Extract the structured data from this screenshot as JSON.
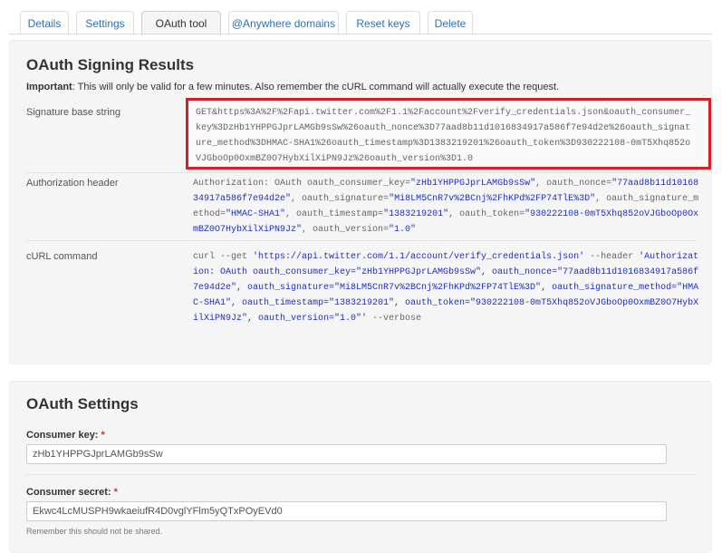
{
  "tabs": [
    {
      "label": "Details"
    },
    {
      "label": "Settings"
    },
    {
      "label": "OAuth tool"
    },
    {
      "label": "@Anywhere domains"
    },
    {
      "label": "Reset keys"
    },
    {
      "label": "Delete"
    }
  ],
  "results": {
    "title": "OAuth Signing Results",
    "important_label": "Important",
    "important_text": ": This will only be valid for a few minutes. Also remember the cURL command will actually execute the request.",
    "signature_label": "Signature base string",
    "signature_value": "GET&https%3A%2F%2Fapi.twitter.com%2F1.1%2Faccount%2Fverify_credentials.json&oauth_consumer_key%3DzHb1YHPPGJprLAMGb9sSw%26oauth_nonce%3D77aad8b11d1016834917a586f7e94d2e%26oauth_signature_method%3DHMAC-SHA1%26oauth_timestamp%3D1383219201%26oauth_token%3D930222108-0mT5Xhq852oVJGboOp0OxmBZ0O7HybXilXiPN9Jz%26oauth_version%3D1.0",
    "auth_label": "Authorization header",
    "auth_value": "Authorization: OAuth oauth_consumer_key=\"zHb1YHPPGJprLAMGb9sSw\", oauth_nonce=\"77aad8b11d1016834917a586f7e94d2e\", oauth_signature=\"Mi8LM5CnR7v%2BCnj%2FhKPd%2FP74TlE%3D\", oauth_signature_method=\"HMAC-SHA1\", oauth_timestamp=\"1383219201\", oauth_token=\"930222108-0mT5Xhq852oVJGboOp0OxmBZ0O7HybXilXiPN9Jz\", oauth_version=\"1.0\"",
    "curl_label": "cURL command",
    "curl_value": "curl --get 'https://api.twitter.com/1.1/account/verify_credentials.json' --header 'Authorization: OAuth oauth_consumer_key=\"zHb1YHPPGJprLAMGb9sSw\", oauth_nonce=\"77aad8b11d1016834917a586f7e94d2e\", oauth_signature=\"Mi8LM5CnR7v%2BCnj%2FhKPd%2FP74TlE%3D\", oauth_signature_method=\"HMAC-SHA1\", oauth_timestamp=\"1383219201\", oauth_token=\"930222108-0mT5Xhq852oVJGboOp0OxmBZ0O7HybXilXiPN9Jz\", oauth_version=\"1.0\"' --verbose"
  },
  "settings": {
    "title": "OAuth Settings",
    "consumer_key_label": "Consumer key:",
    "consumer_key_value": "zHb1YHPPGJprLAMGb9sSw",
    "consumer_secret_label": "Consumer secret:",
    "consumer_secret_value": "Ekwc4LcMUSPH9wkaeiufR4D0vglYFlm5yQTxPOyEVd0",
    "required_mark": "*",
    "secret_help": "Remember this should not be shared."
  },
  "colors": {
    "link": "#2a72b5",
    "highlight_border": "#d42027",
    "string_literal": "#2030c0"
  }
}
